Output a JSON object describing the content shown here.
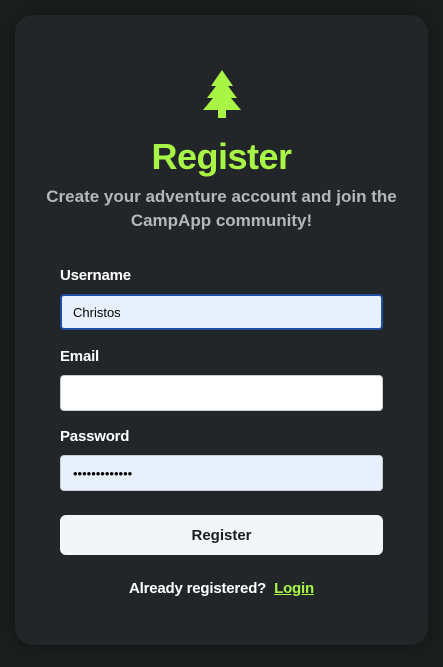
{
  "header": {
    "icon": "pine-tree-icon",
    "title": "Register",
    "subtitle": "Create your adventure account and join the CampApp community!"
  },
  "form": {
    "username": {
      "label": "Username",
      "value": "Christos"
    },
    "email": {
      "label": "Email",
      "value": ""
    },
    "password": {
      "label": "Password",
      "value": "•••••••••••••"
    },
    "submit_label": "Register"
  },
  "footer": {
    "prompt": "Already registered?",
    "link_label": "Login"
  },
  "colors": {
    "accent": "#a8f546",
    "card_bg": "#222629",
    "page_bg": "#1b1e1c",
    "focus_border": "#1f4fa3",
    "autofill_bg": "#e8f0fe"
  }
}
